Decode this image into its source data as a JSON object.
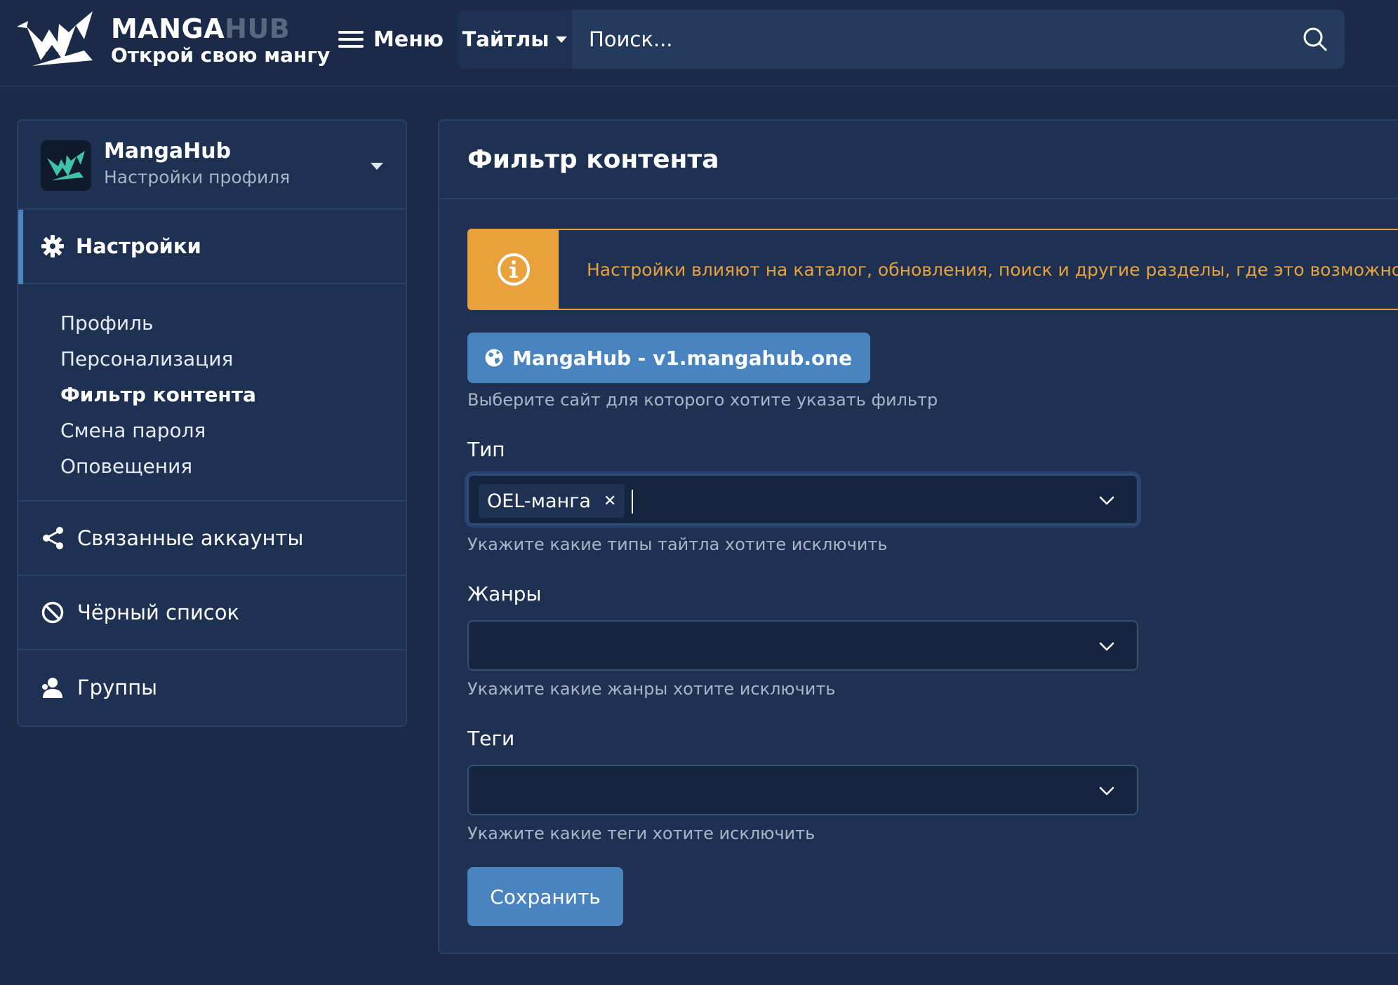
{
  "header": {
    "brand_manga": "MANGA",
    "brand_hub": "HUB",
    "tagline": "Открой свою мангу",
    "menu_label": "Меню",
    "search_category": "Тайтлы",
    "search_placeholder": "Поиск..."
  },
  "sidebar": {
    "profile_name": "MangaHub",
    "profile_sub": "Настройки профиля",
    "settings_label": "Настройки",
    "subnav": [
      "Профиль",
      "Персонализация",
      "Фильтр контента",
      "Смена пароля",
      "Оповещения"
    ],
    "active_subnav": "Фильтр контента",
    "items": [
      "Связанные аккаунты",
      "Чёрный список",
      "Группы"
    ]
  },
  "main": {
    "title": "Фильтр контента",
    "alert": "Настройки влияют на каталог, обновления, поиск и другие разделы, где это возможно",
    "site_button": "MangaHub - v1.mangahub.one",
    "site_help": "Выберите сайт для которого хотите указать фильтр",
    "fields": [
      {
        "label": "Тип",
        "chips": [
          "OEL-манга"
        ],
        "help": "Укажите какие типы тайтла хотите исключить"
      },
      {
        "label": "Жанры",
        "chips": [],
        "help": "Укажите какие жанры хотите исключить"
      },
      {
        "label": "Теги",
        "chips": [],
        "help": "Укажите какие теги хотите исключить"
      }
    ],
    "save_label": "Сохранить"
  },
  "colors": {
    "background": "#1a2a48",
    "panel": "#1e3152",
    "accent": "#4a84c0",
    "warning": "#e9a23b"
  },
  "icons": [
    "logo-crane-icon",
    "hamburger-icon",
    "caret-down-icon",
    "search-icon",
    "gear-icon",
    "share-icon",
    "block-icon",
    "users-icon",
    "info-icon",
    "globe-icon",
    "chevron-down-icon",
    "close-icon"
  ]
}
